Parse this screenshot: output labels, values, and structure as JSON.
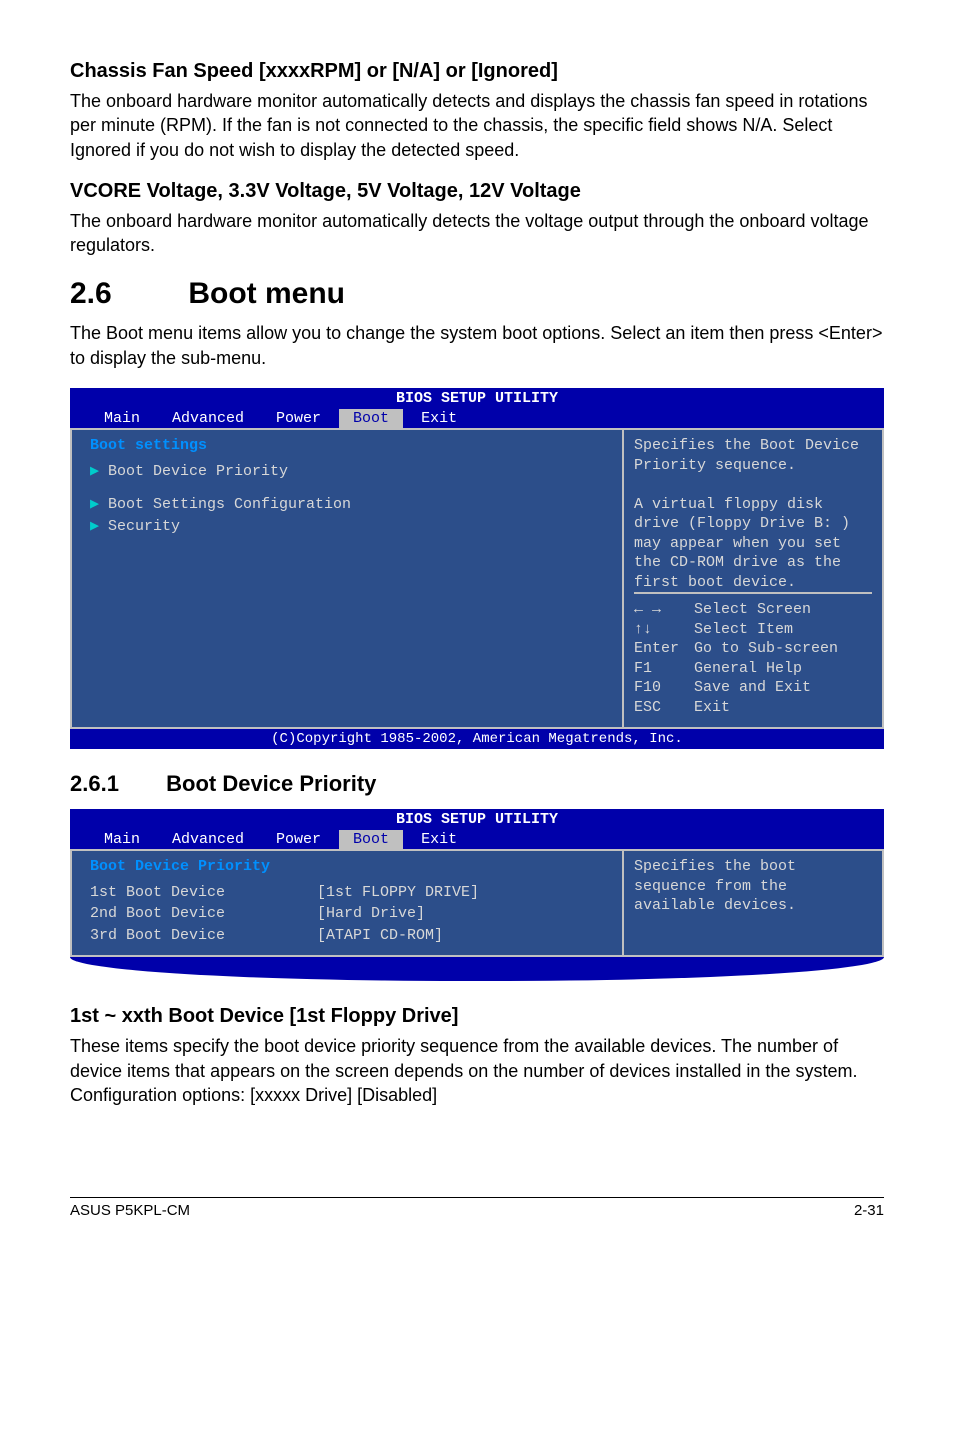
{
  "sec1": {
    "h": "Chassis Fan Speed [xxxxRPM] or [N/A] or [Ignored]",
    "p": "The onboard hardware monitor automatically detects and displays the chassis fan speed in rotations per minute (RPM). If the fan is not connected to the chassis, the specific field shows N/A. Select Ignored if you do not wish to display the detected speed."
  },
  "sec2": {
    "h": "VCORE Voltage, 3.3V Voltage, 5V Voltage, 12V Voltage",
    "p": "The onboard hardware monitor automatically detects the voltage output through the onboard voltage regulators."
  },
  "sec3": {
    "num": "2.6",
    "title": "Boot menu",
    "p": "The Boot menu items allow you to change the system boot options. Select an item then press <Enter> to display the sub-menu."
  },
  "bios1": {
    "titlebar": "BIOS SETUP UTILITY",
    "tabs": [
      "Main",
      "Advanced",
      "Power",
      "Boot",
      "Exit"
    ],
    "activeTab": "Boot",
    "heading": "Boot settings",
    "rows": [
      {
        "arrow": true,
        "highlight": true,
        "text": "Boot Device Priority"
      },
      {
        "arrow": true,
        "highlight": false,
        "text": "Boot Settings Configuration"
      },
      {
        "arrow": true,
        "highlight": false,
        "text": "Security"
      }
    ],
    "helpTop": "Specifies the Boot Device Priority sequence.\n\nA virtual floppy disk drive (Floppy Drive B: ) may appear when you set the CD-ROM drive as the first boot device.",
    "helpBottom": [
      {
        "k": "← →",
        "v": "Select Screen"
      },
      {
        "k": "↑↓",
        "v": "Select Item"
      },
      {
        "k": "Enter",
        "v": "Go to Sub-screen"
      },
      {
        "k": "F1",
        "v": "General Help"
      },
      {
        "k": "F10",
        "v": "Save and Exit"
      },
      {
        "k": "ESC",
        "v": "Exit"
      }
    ],
    "copyright": "(C)Copyright 1985-2002, American Megatrends, Inc."
  },
  "sec4": {
    "num": "2.6.1",
    "title": "Boot Device Priority"
  },
  "bios2": {
    "titlebar": "BIOS SETUP UTILITY",
    "tabs": [
      "Main",
      "Advanced",
      "Power",
      "Boot",
      "Exit"
    ],
    "activeTab": "Boot",
    "heading": "Boot Device Priority",
    "rows": [
      {
        "label": "1st Boot Device",
        "value": "[1st FLOPPY DRIVE]",
        "highlight": true
      },
      {
        "label": "2nd Boot Device",
        "value": "[Hard Drive]",
        "highlight": false
      },
      {
        "label": "3rd Boot Device",
        "value": "[ATAPI CD-ROM]",
        "highlight": false
      }
    ],
    "helpTop": "Specifies the boot sequence from the available devices."
  },
  "sec5": {
    "h": "1st ~ xxth Boot Device [1st Floppy Drive]",
    "p": "These items specify the boot device priority sequence from the available devices. The number of device items that appears on the screen depends on the number of devices installed in the system. Configuration options: [xxxxx Drive] [Disabled]"
  },
  "footer": {
    "left": "ASUS P5KPL-CM",
    "right": "2-31"
  }
}
